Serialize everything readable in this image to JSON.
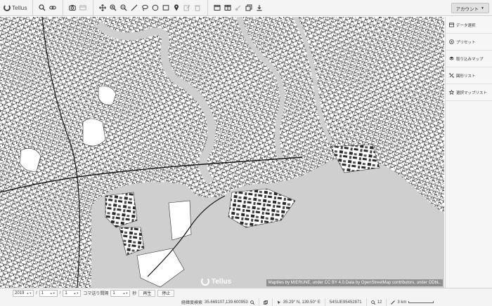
{
  "app": {
    "logo_text": "Tellus"
  },
  "toolbar": {
    "groups": [
      [
        "search-icon",
        "link-icon"
      ],
      [
        "camera-icon",
        "card-icon"
      ],
      [
        "move-icon",
        "zoom-in-icon",
        "zoom-out-icon",
        "line-icon",
        "lasso-icon",
        "circle-icon",
        "rectangle-icon",
        "pin-icon",
        "edit-icon",
        "trash-icon"
      ],
      [
        "window-icon",
        "split-icon",
        "compare-icon",
        "layers-icon",
        "download-icon"
      ]
    ],
    "account_label": "アカウント"
  },
  "sidebar": {
    "items": [
      {
        "label": "データ選択",
        "icon": "data-icon"
      },
      {
        "label": "プリセット",
        "icon": "preset-icon"
      },
      {
        "label": "取り込みマップ",
        "icon": "import-map-icon"
      },
      {
        "label": "図形リスト",
        "icon": "shape-list-icon"
      },
      {
        "label": "選択マップリスト",
        "icon": "map-list-icon"
      }
    ]
  },
  "map": {
    "attribution": "Maptiles by MIERUNE, under CC BY 4.0.Data by OpenStreetMap contributors, under ODbL.",
    "logo_text": "Tellus",
    "land_color": "#ffffff",
    "water_color": "#cfcfcf",
    "road_color": "#1a1a1a"
  },
  "timebar": {
    "year": "2019",
    "month": "1",
    "day": "1",
    "step_label": "コマ送り間隔",
    "step_value": "1",
    "unit": "秒",
    "play_label": "再生",
    "stop_label": "停止"
  },
  "status": {
    "search_label": "経緯度検索",
    "latlon": "35.669107,139.600953",
    "center": "35.29° N, 139.50° E",
    "mesh_code": "54SUE95452871",
    "zoom": "12",
    "scale": "3 km"
  }
}
